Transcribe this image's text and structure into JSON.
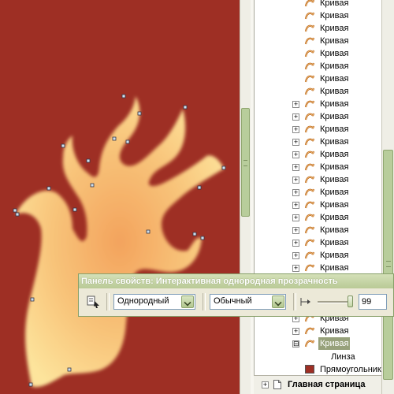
{
  "object_manager": {
    "curve_label": "Кривая",
    "lens_label": "Линза",
    "rectangle_label": "Прямоугольник",
    "home_page_label": "Главная страница",
    "expanded_symbol": "⊟",
    "collapsed_symbol": "+",
    "rectangle_color": "#9e2f24"
  },
  "property_bar": {
    "title": "Панель свойств: Интерактивная однородная прозрачность",
    "transparency_type": "Однородный",
    "merge_mode": "Обычный",
    "transparency_value": "99"
  },
  "canvas": {
    "background_color": "#9e2f24",
    "flame_color_outer": "#f2a25c",
    "flame_color_inner": "#fde39a"
  }
}
